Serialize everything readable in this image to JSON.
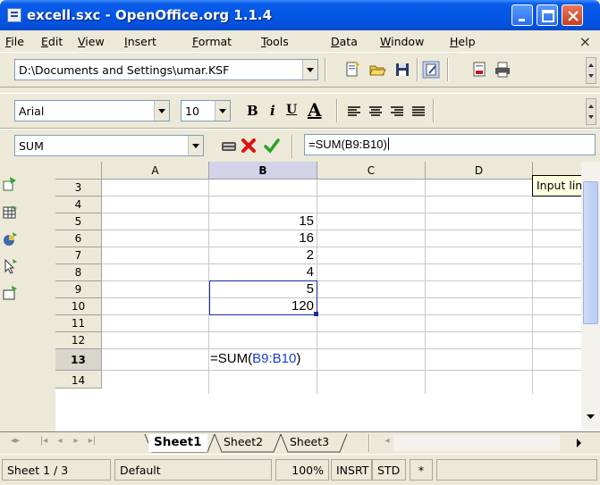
{
  "window": {
    "title": "excell.sxc - OpenOffice.org 1.1.4"
  },
  "menu": {
    "items": [
      {
        "u": "F",
        "rest": "ile"
      },
      {
        "u": "E",
        "rest": "dit"
      },
      {
        "u": "V",
        "rest": "iew"
      },
      {
        "u": "I",
        "rest": "nsert"
      },
      {
        "u": "F",
        "rest": "ormat"
      },
      {
        "u": "T",
        "rest": "ools"
      },
      {
        "u": "D",
        "rest": "ata"
      },
      {
        "u": "W",
        "rest": "indow"
      },
      {
        "u": "H",
        "rest": "elp"
      }
    ],
    "close_glyph": "×"
  },
  "toolbar": {
    "path": "D:\\Documents and Settings\\umar.KSF"
  },
  "format": {
    "font_name": "Arial",
    "font_size": "10",
    "bold": "B",
    "italic": "i",
    "underline": "U",
    "font_color": "A"
  },
  "formula_bar": {
    "name_box": "SUM",
    "formula": "=SUM(B9:B10)",
    "tooltip": "Input line"
  },
  "sheet": {
    "columns": [
      "A",
      "B",
      "C",
      "D"
    ],
    "rows": [
      "3",
      "4",
      "5",
      "6",
      "7",
      "8",
      "9",
      "10",
      "11",
      "12",
      "13",
      "14"
    ],
    "active_column": "B",
    "active_row": "13",
    "cells": [
      {
        "row": "5",
        "col": "B",
        "value": "15"
      },
      {
        "row": "6",
        "col": "B",
        "value": "16"
      },
      {
        "row": "7",
        "col": "B",
        "value": "2"
      },
      {
        "row": "8",
        "col": "B",
        "value": "4"
      },
      {
        "row": "9",
        "col": "B",
        "value": "5"
      },
      {
        "row": "10",
        "col": "B",
        "value": "120"
      }
    ],
    "formula_cell": {
      "prefix": "=SUM(",
      "ref": "B9:B10",
      "suffix": ")"
    }
  },
  "tabs": [
    "Sheet1",
    "Sheet2",
    "Sheet3"
  ],
  "active_tab": "Sheet1",
  "status": {
    "sheet": "Sheet 1 / 3",
    "style": "Default",
    "zoom": "100%",
    "insert": "INSRT",
    "selection": "STD",
    "modified": "*"
  },
  "colors": {
    "title_bar": "#0456e6",
    "selection": "#1a2aa0",
    "reference": "#1a3ad0"
  }
}
